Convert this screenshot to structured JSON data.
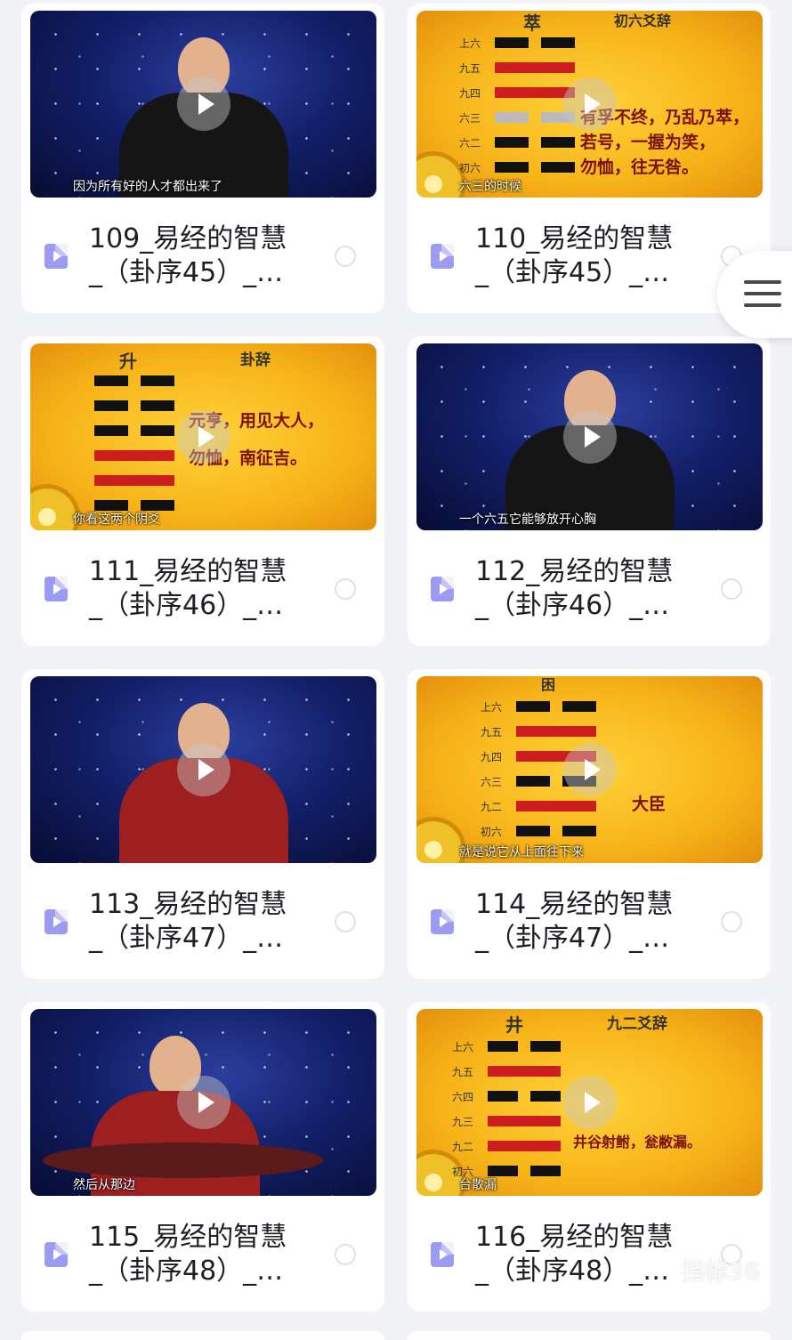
{
  "videos": [
    {
      "title_line1": "109_易经的智慧",
      "title_line2": "_（卦序45）_…",
      "caption": "因为所有好的人才都出来了",
      "thumb_style": "stage"
    },
    {
      "title_line1": "110_易经的智慧",
      "title_line2": "_（卦序45）_…",
      "caption": "六三的时候",
      "thumb_style": "gold",
      "slide": {
        "hex_name": "萃",
        "heading": "初六爻辞",
        "lines": [
          "上六",
          "九五",
          "九四",
          "六三",
          "六二",
          "初六"
        ],
        "verse": [
          "有孚不终，乃乱乃萃，",
          "若号，一握为笑，",
          "勿恤，往无咎。"
        ]
      }
    },
    {
      "title_line1": "111_易经的智慧",
      "title_line2": "_（卦序46）_…",
      "caption": "你看这两个阴爻",
      "thumb_style": "gold",
      "slide": {
        "hex_name": "升",
        "heading": "卦辞",
        "verse": [
          "元亨，用见大人，",
          "勿恤，南征吉。"
        ]
      }
    },
    {
      "title_line1": "112_易经的智慧",
      "title_line2": "_（卦序46）_…",
      "caption": "一个六五它能够放开心胸",
      "thumb_style": "stage"
    },
    {
      "title_line1": "113_易经的智慧",
      "title_line2": "_（卦序47）_…",
      "caption": "",
      "thumb_style": "stage"
    },
    {
      "title_line1": "114_易经的智慧",
      "title_line2": "_（卦序47）_…",
      "caption": "就是说它从上面往下来",
      "thumb_style": "gold",
      "slide": {
        "hex_name": "困",
        "lines": [
          "上六",
          "九五",
          "九四",
          "六三",
          "九二",
          "初六"
        ],
        "verse": [
          "大臣"
        ]
      }
    },
    {
      "title_line1": "115_易经的智慧",
      "title_line2": "_（卦序48）_…",
      "caption": "然后从那边",
      "thumb_style": "stage"
    },
    {
      "title_line1": "116_易经的智慧",
      "title_line2": "_（卦序48）_…",
      "caption": "台散漏",
      "thumb_style": "gold",
      "slide": {
        "hex_name": "井",
        "heading": "九二爻辞",
        "lines": [
          "上六",
          "九五",
          "六四",
          "九三",
          "九二",
          "初六"
        ],
        "verse": [
          "井谷射鲋，瓮敝漏。"
        ]
      }
    }
  ],
  "watermark": "指标36",
  "menu_icon": "hamburger-menu-icon",
  "colors": {
    "file_icon": "#9b9bf2",
    "slide_gold": "#f7b419",
    "stage_blue": "#13206b"
  }
}
